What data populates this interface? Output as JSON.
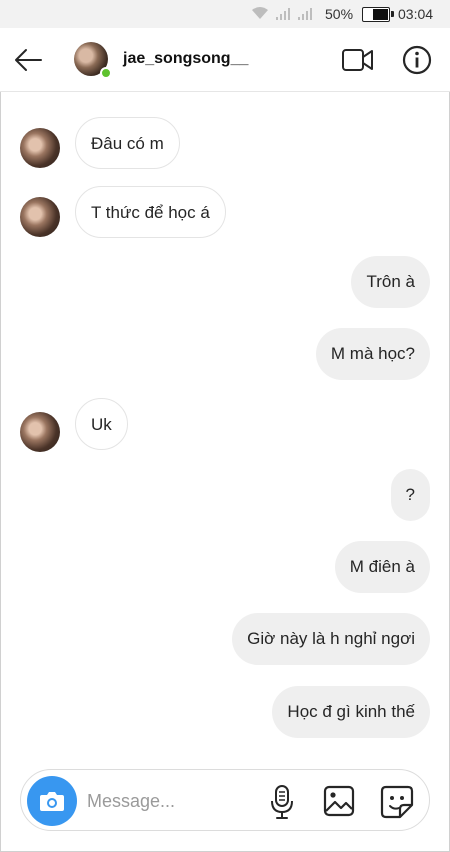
{
  "status_bar": {
    "battery_percent": "50%",
    "time": "03:04",
    "icons": [
      "wifi-icon",
      "signal-icon",
      "signal-icon",
      "battery-icon"
    ]
  },
  "header": {
    "username": "jae_songsong__",
    "online": true,
    "icons": [
      "back-arrow-icon",
      "video-call-icon",
      "info-icon"
    ]
  },
  "messages": [
    {
      "direction": "in",
      "text": "Đâu có m"
    },
    {
      "direction": "in",
      "text": "T thức để học á"
    },
    {
      "direction": "out",
      "text": "Trôn à"
    },
    {
      "direction": "out",
      "text": "M mà học?"
    },
    {
      "direction": "in",
      "text": "Uk"
    },
    {
      "direction": "out",
      "text": "?"
    },
    {
      "direction": "out",
      "text": "M điên à"
    },
    {
      "direction": "out",
      "text": "Giờ này là h nghỉ ngơi"
    },
    {
      "direction": "out",
      "text": "Học đ gì kinh thế"
    }
  ],
  "composer": {
    "placeholder": "Message...",
    "value": "",
    "icons": [
      "camera-icon",
      "microphone-icon",
      "gallery-icon",
      "sticker-icon"
    ]
  },
  "colors": {
    "accent_blue": "#3897f0",
    "online_green": "#5ec22e",
    "outgoing_bubble": "#efefef"
  }
}
